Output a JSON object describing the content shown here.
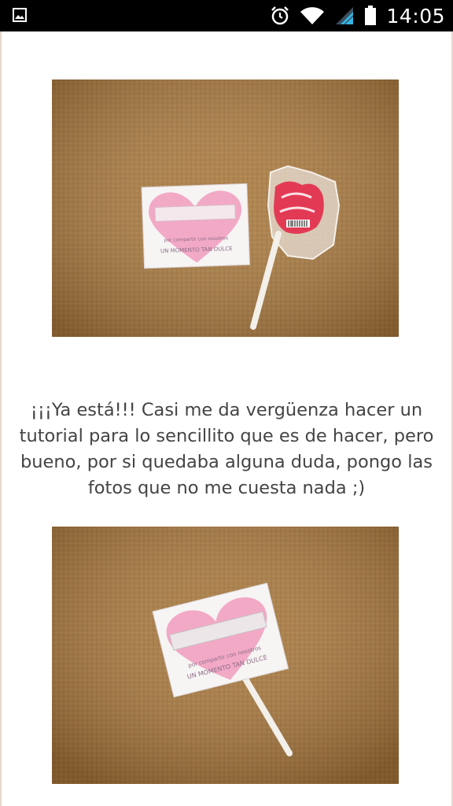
{
  "status_bar": {
    "time": "14:05",
    "icons": [
      "image-notification-icon",
      "alarm-icon",
      "wifi-icon",
      "signal-icon",
      "battery-icon"
    ]
  },
  "article": {
    "photos": [
      {
        "name": "lollipop-photo-card-beside"
      },
      {
        "name": "lollipop-photo-card-attached"
      }
    ],
    "caption": "¡¡¡Ya está!!! Casi me da vergüenza hacer un tutorial para lo sencillito que es de hacer, pero bueno, por si quedaba alguna duda, pongo las fotos que no me cuesta nada ;)"
  },
  "card": {
    "line1": "por compartir con nosotros",
    "line2": "UN MOMENTO TAN DULCE"
  },
  "colors": {
    "background_fabric": "#a8793f",
    "card_pink": "#f2a9c6",
    "lollipop_red": "#e23a55"
  }
}
